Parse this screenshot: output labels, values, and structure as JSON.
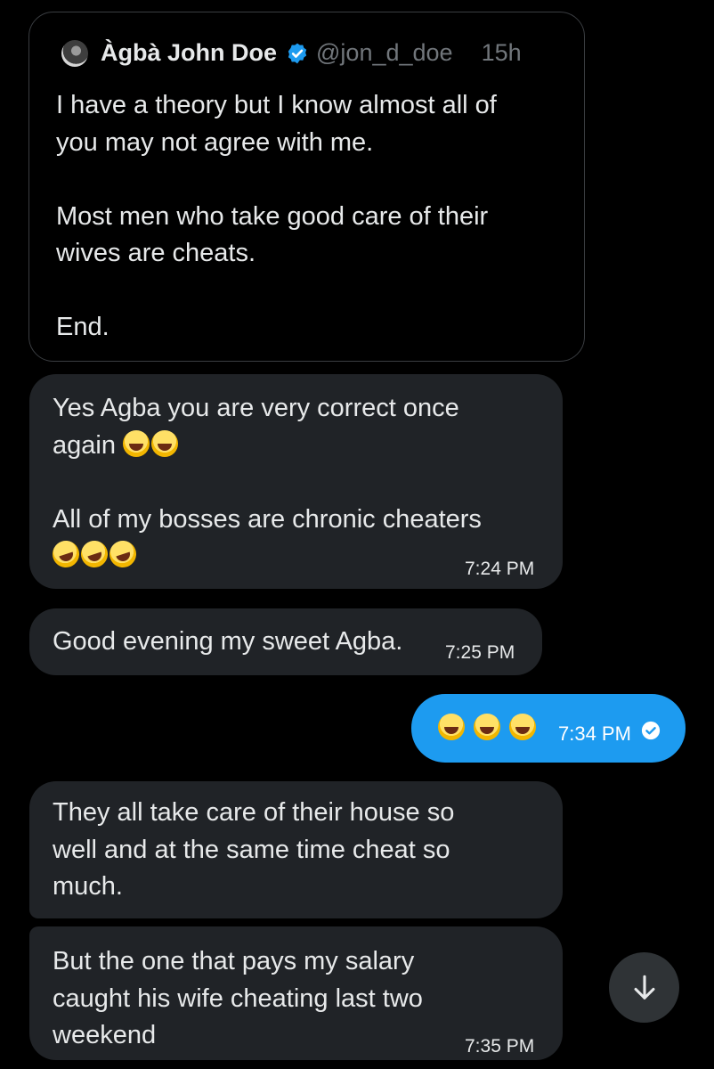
{
  "quoted_post": {
    "name": "Àgbà John Doe",
    "handle": "@jon_d_doe",
    "time": "15h",
    "text": "I have a theory but I know almost all of\nyou may not agree with me.\n\nMost men who take good care of their\nwives are cheats.\n\nEnd."
  },
  "messages": [
    {
      "direction": "received",
      "text_a": "Yes Agba you are very correct once\nagain ",
      "text_b": "\n\nAll of my bosses are chronic cheaters\n",
      "time": "7:24 PM"
    },
    {
      "direction": "received",
      "text": "Good evening my sweet Agba.",
      "time": "7:25 PM"
    },
    {
      "direction": "sent",
      "time": "7:34 PM",
      "status": "read"
    },
    {
      "direction": "received",
      "text": "They all take care of their house so\nwell and at the same time cheat so\nmuch."
    },
    {
      "direction": "received",
      "text": "But the one that pays my salary\ncaught his wife cheating last two\nweekend",
      "time": "7:35 PM"
    }
  ],
  "colors": {
    "background": "#000000",
    "received_bubble": "#202327",
    "sent_bubble": "#1d9bf0",
    "verified_badge": "#1d9bf0",
    "secondary_text": "#71767b"
  },
  "icons": {
    "verified": "verified-badge-icon",
    "read_receipt": "read-check-icon",
    "scroll_down": "arrow-down-icon",
    "laugh": "grinning-sweat-emoji",
    "rofl": "rolling-laughing-emoji"
  }
}
